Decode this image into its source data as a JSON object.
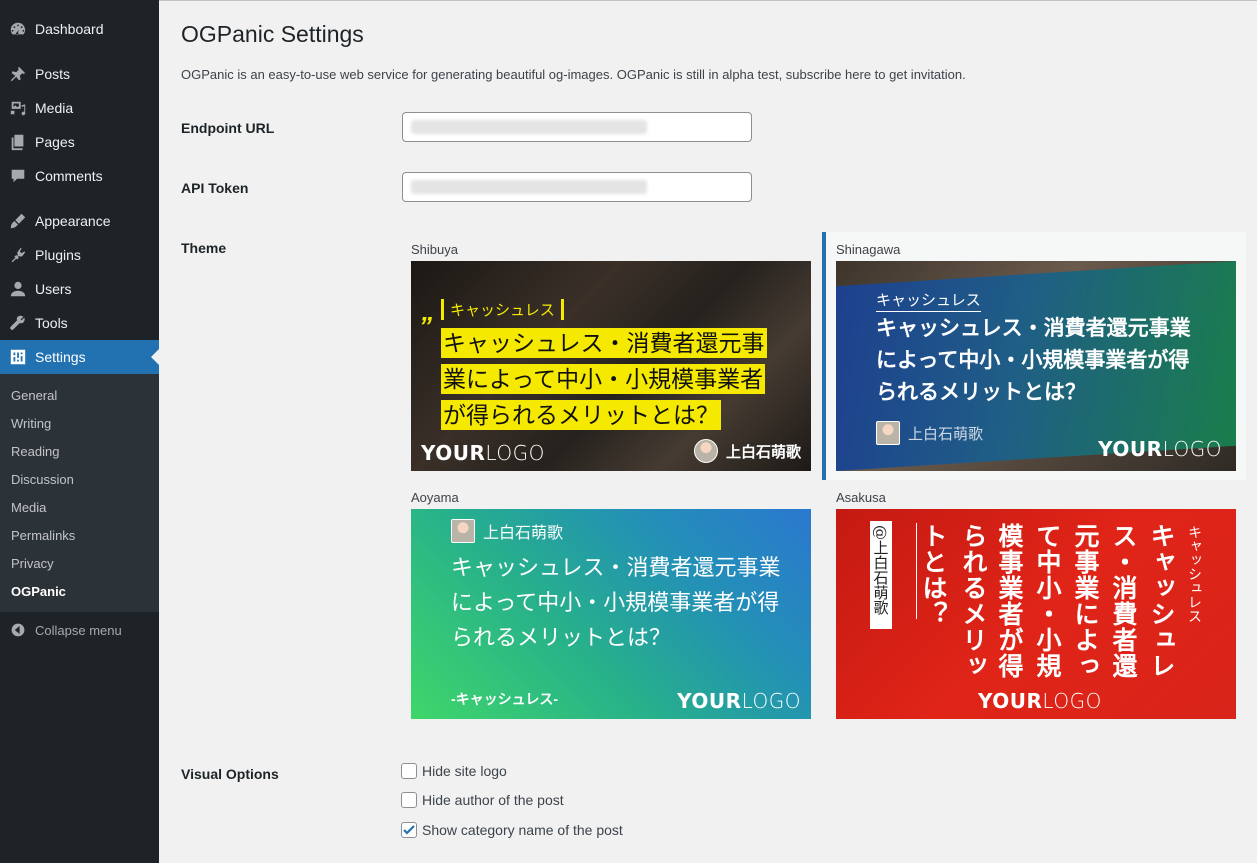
{
  "sidebar": {
    "items": [
      {
        "label": "Dashboard",
        "icon": "dashboard-icon"
      },
      {
        "label": "Posts",
        "icon": "pin-icon"
      },
      {
        "label": "Media",
        "icon": "media-icon"
      },
      {
        "label": "Pages",
        "icon": "pages-icon"
      },
      {
        "label": "Comments",
        "icon": "comment-icon"
      },
      {
        "label": "Appearance",
        "icon": "brush-icon"
      },
      {
        "label": "Plugins",
        "icon": "plugin-icon"
      },
      {
        "label": "Users",
        "icon": "user-icon"
      },
      {
        "label": "Tools",
        "icon": "wrench-icon"
      },
      {
        "label": "Settings",
        "icon": "settings-icon"
      }
    ],
    "submenu": [
      "General",
      "Writing",
      "Reading",
      "Discussion",
      "Media",
      "Permalinks",
      "Privacy",
      "OGPanic"
    ],
    "current_submenu": "OGPanic",
    "collapse_label": "Collapse menu"
  },
  "page": {
    "title": "OGPanic Settings",
    "description": "OGPanic is an easy-to-use web service for generating beautiful og-images. OGPanic is still in alpha test, subscribe here to get invitation."
  },
  "fields": {
    "endpoint_label": "Endpoint URL",
    "token_label": "API Token",
    "theme_label": "Theme",
    "visual_label": "Visual Options"
  },
  "themes": {
    "selected": "Shinagawa",
    "shibuya": {
      "name": "Shibuya",
      "tag": "キャッシュレス",
      "quote": "”",
      "title_lines": [
        "キャッシュレス・消費者還元事",
        "業によって中小・小規模事業者",
        "が得られるメリットとは？"
      ],
      "author": "上白石萌歌",
      "logo_bold": "YOUR",
      "logo_light": "LOGO"
    },
    "shinagawa": {
      "name": "Shinagawa",
      "tag": "キャッシュレス",
      "title": "キャッシュレス・消費者還元事業によって中小・小規模事業者が得られるメリットとは？",
      "author": "上白石萌歌",
      "logo_bold": "YOUR",
      "logo_light": "LOGO"
    },
    "aoyama": {
      "name": "Aoyama",
      "author": "上白石萌歌",
      "title": "キャッシュレス・消費者還元事業によって中小・小規模事業者が得られるメリットとは？",
      "tag": "-キャッシュレス-",
      "logo_bold": "YOUR",
      "logo_light": "LOGO"
    },
    "asakusa": {
      "name": "Asakusa",
      "tag": "キャッシュレス",
      "title_columns": [
        "キャッシュレ",
        "ス・消費者還",
        "元事業によっ",
        "て中小・小規",
        "模事業者が得",
        "られるメリッ",
        "トとは？"
      ],
      "author": "@上白石萌歌",
      "logo_bold": "YOUR",
      "logo_light": "LOGO"
    }
  },
  "visual_options": [
    {
      "label": "Hide site logo",
      "checked": false
    },
    {
      "label": "Hide author of the post",
      "checked": false
    },
    {
      "label": "Show category name of the post",
      "checked": true
    }
  ],
  "colors": {
    "sidebar_bg": "#1d2327",
    "accent": "#2271b1",
    "shibuya_highlight": "#f5e900",
    "asakusa_red": "#e02418"
  }
}
